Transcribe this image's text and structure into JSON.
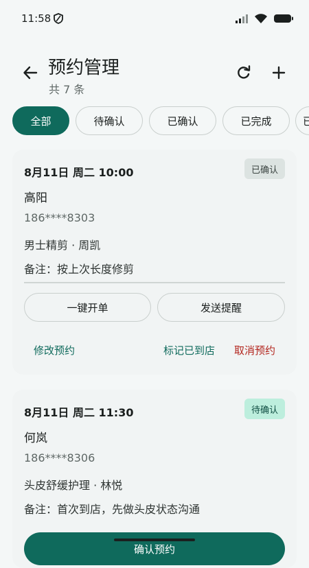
{
  "status_bar": {
    "time": "11:58"
  },
  "header": {
    "title": "预约管理",
    "subtitle": "共 7 条"
  },
  "filters": [
    {
      "label": "全部",
      "active": true
    },
    {
      "label": "待确认",
      "active": false
    },
    {
      "label": "已确认",
      "active": false
    },
    {
      "label": "已完成",
      "active": false
    },
    {
      "label": "已",
      "active": false
    }
  ],
  "appointments": [
    {
      "datetime": "8月11日 周二 10:00",
      "status": "已确认",
      "name": "高阳",
      "phone": "186****8303",
      "service": "男士精剪 · 周凯",
      "note": "备注：按上次长度修剪",
      "buttons": {
        "open_order": "一键开单",
        "send_reminder": "发送提醒"
      },
      "actions": {
        "modify": "修改预约",
        "mark_arrived": "标记已到店",
        "cancel": "取消预约"
      }
    },
    {
      "datetime": "8月11日 周二 11:30",
      "status": "待确认",
      "name": "何岚",
      "phone": "186****8306",
      "service": "头皮舒缓护理 · 林悦",
      "note": "备注：首次到店，先做头皮状态沟通",
      "buttons": {
        "confirm": "确认预约"
      }
    }
  ],
  "colors": {
    "accent": "#0f6a5c",
    "danger": "#b3261e",
    "background": "#f4f7f7"
  }
}
